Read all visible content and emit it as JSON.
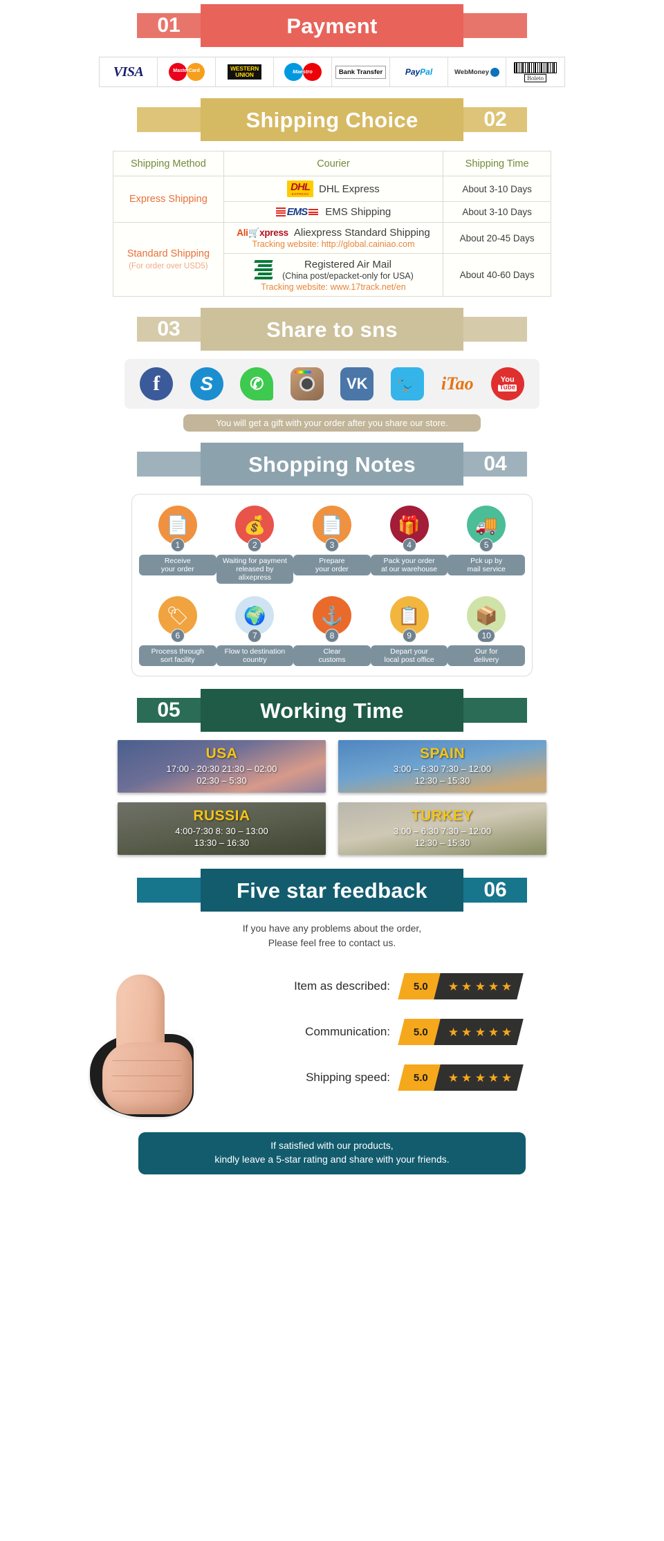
{
  "sections": {
    "payment": {
      "number": "01",
      "title": "Payment",
      "color": "#e8635a",
      "methods": [
        {
          "name": "visa-logo",
          "label": "VISA"
        },
        {
          "name": "mastercard-logo",
          "label": "MasterCard"
        },
        {
          "name": "western-union-logo",
          "label_line1": "WESTERN",
          "label_line2": "UNION"
        },
        {
          "name": "maestro-logo",
          "label": "Maestro"
        },
        {
          "name": "bank-transfer-logo",
          "label": "Bank Transfer"
        },
        {
          "name": "paypal-logo",
          "label": "Pay",
          "label2": "Pal"
        },
        {
          "name": "webmoney-logo",
          "label": "WebMoney"
        },
        {
          "name": "boleto-logo",
          "label": "Boleto"
        }
      ]
    },
    "shipping": {
      "number": "02",
      "title": "Shipping Choice",
      "color": "#d6b963",
      "headers": {
        "method": "Shipping Method",
        "courier": "Courier",
        "time": "Shipping Time"
      },
      "express": {
        "name": "Express Shipping",
        "rows": [
          {
            "logo": "dhl-logo",
            "logo_text": "DHL",
            "logo_sub": "EXPRESS",
            "courier": "DHL Express",
            "time": "About 3-10 Days"
          },
          {
            "logo": "ems-logo",
            "logo_text": "EMS",
            "courier": "EMS Shipping",
            "time": "About 3-10 Days"
          }
        ]
      },
      "standard": {
        "name": "Standard Shipping",
        "sub": "(For order over USD5)",
        "rows": [
          {
            "logo": "aliexpress-logo",
            "logo_text_a": "Ali",
            "logo_text_b": "xpress",
            "courier": "Aliexpress Standard Shipping",
            "tracking": "Tracking website: http://global.cainiao.com",
            "time": "About 20-45 Days"
          },
          {
            "logo": "china-post-logo",
            "courier": "Registered Air Mail",
            "courier_sub": "(China post/epacket-only for USA)",
            "tracking": "Tracking website: www.17track.net/en",
            "time": "About 40-60 Days"
          }
        ]
      }
    },
    "share": {
      "number": "03",
      "title": "Share to sns",
      "color": "#cdc19b",
      "icons": [
        {
          "name": "facebook-icon",
          "glyph": "f"
        },
        {
          "name": "skype-icon",
          "glyph": "S"
        },
        {
          "name": "whatsapp-icon",
          "glyph": "✆"
        },
        {
          "name": "instagram-icon",
          "glyph": ""
        },
        {
          "name": "vk-icon",
          "glyph": "VK"
        },
        {
          "name": "twitter-icon",
          "glyph": "🐦"
        },
        {
          "name": "itao-icon",
          "glyph": "iTao"
        },
        {
          "name": "youtube-icon",
          "glyph": "You",
          "glyph2": "Tube"
        }
      ],
      "note": "You will get a gift with your order after you share our store."
    },
    "notes": {
      "number": "04",
      "title": "Shopping Notes",
      "color": "#8ca3ae",
      "steps": [
        {
          "num": "1",
          "label": "Receive\nyour order",
          "icon": "document-icon",
          "color": "#f0913f"
        },
        {
          "num": "2",
          "label": "Waiting for payment\nreleased by alixepress",
          "icon": "money-bag-icon",
          "color": "#e8534a"
        },
        {
          "num": "3",
          "label": "Prepare\nyour order",
          "icon": "document-icon",
          "color": "#f0913f"
        },
        {
          "num": "4",
          "label": "Pack your order\nat our warehouse",
          "icon": "gift-box-icon",
          "color": "#a31c38"
        },
        {
          "num": "5",
          "label": "Pck up by\nmail service",
          "icon": "mail-truck-icon",
          "color": "#4bbd97"
        },
        {
          "num": "6",
          "label": "Process through\nsort facility",
          "icon": "sort-facility-icon",
          "color": "#f0a33f"
        },
        {
          "num": "7",
          "label": "Flow to destination\ncountry",
          "icon": "globe-icon",
          "color": "#cfe3f2"
        },
        {
          "num": "8",
          "label": "Clear\ncustoms",
          "icon": "anchor-icon",
          "color": "#ea6a2c"
        },
        {
          "num": "9",
          "label": "Depart your\nlocal post office",
          "icon": "postman-icon",
          "color": "#f2b63f"
        },
        {
          "num": "10",
          "label": "Our for\ndelivery",
          "icon": "package-icon",
          "color": "#cfe2a8"
        }
      ]
    },
    "working_time": {
      "number": "05",
      "title": "Working Time",
      "color": "#1f5b46",
      "cards": [
        {
          "country": "USA",
          "times_line1": "17:00 - 20:30  21:30 – 02:00",
          "times_line2": "02:30 – 5:30",
          "theme": "wt-usa"
        },
        {
          "country": "SPAIN",
          "times_line1": "3:00 – 6:30   7:30 – 12:00",
          "times_line2": "12:30 – 15:30",
          "theme": "wt-spain"
        },
        {
          "country": "RUSSIA",
          "times_line1": "4:00-7:30  8: 30 – 13:00",
          "times_line2": "13:30 – 16:30",
          "theme": "wt-russia"
        },
        {
          "country": "TURKEY",
          "times_line1": "3:00 – 6:30   7:30 – 12:00",
          "times_line2": "12:30 – 15:30",
          "theme": "wt-turkey"
        }
      ]
    },
    "feedback": {
      "number": "06",
      "title": "Five star feedback",
      "color": "#125c6e",
      "intro_line1": "If you have any problems about the order,",
      "intro_line2": "Please feel free to contact us.",
      "ratings": [
        {
          "label": "Item as described:",
          "score": "5.0",
          "stars": "★★★★★"
        },
        {
          "label": "Communication:",
          "score": "5.0",
          "stars": "★★★★★"
        },
        {
          "label": "Shipping speed:",
          "score": "5.0",
          "stars": "★★★★★"
        }
      ],
      "footer_line1": "If satisfied with our products,",
      "footer_line2": "kindly leave a 5-star rating and share with your friends."
    }
  }
}
